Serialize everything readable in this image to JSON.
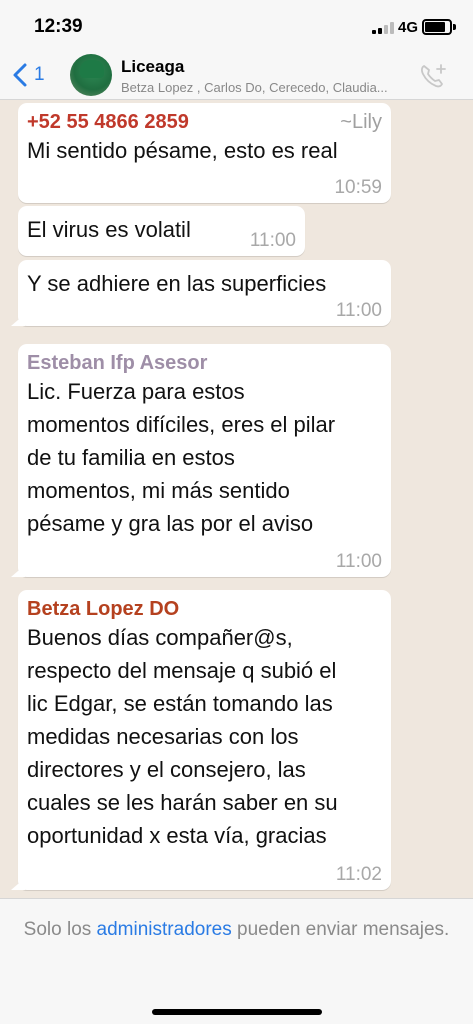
{
  "status_bar": {
    "time": "12:39",
    "network": "4G",
    "battery_level": 0.82
  },
  "header": {
    "back_count": "1",
    "title": "Liceaga",
    "members": "Betza Lopez , Carlos Do, Cerecedo, Claudia..."
  },
  "messages": [
    {
      "sender": "+52 55 4866 2859",
      "alias": "~Lily",
      "text": "Mi sentido pésame, esto es real",
      "time": "10:59"
    },
    {
      "text": "El virus es volatil",
      "time": "11:00"
    },
    {
      "text": "Y se adhiere en las superficies",
      "time": "11:00"
    },
    {
      "sender": "Esteban Ifp Asesor",
      "lines": [
        "Lic. Fuerza para estos",
        "momentos difíciles, eres el pilar",
        "de tu familia en estos",
        "momentos, mi más sentido",
        "pésame y gra las por el aviso"
      ],
      "time": "11:00"
    },
    {
      "sender": "Betza Lopez  DO",
      "lines": [
        "Buenos días compañer@s,",
        "respecto del mensaje q subió el",
        "lic Edgar, se están tomando las",
        "medidas necesarias con los",
        "directores y el consejero, las",
        "cuales se les harán saber en su",
        "oportunidad x esta vía, gracias"
      ],
      "time": "11:02"
    }
  ],
  "footer": {
    "text_before": "Solo los ",
    "link": "administradores",
    "text_after": " pueden enviar mensajes."
  },
  "colors": {
    "accent": "#2a7be4",
    "chat_background": "#efe7de"
  }
}
